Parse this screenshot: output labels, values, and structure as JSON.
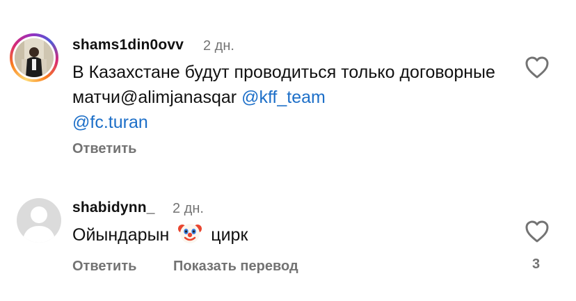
{
  "comments": [
    {
      "username": "shams1din0ovv",
      "time": "2 дн.",
      "text": "В Казахстане будут проводиться только договорные матчи@alimjanasqar",
      "mentions": [
        "@kff_team",
        "@fc.turan"
      ],
      "reply_label": "Ответить"
    },
    {
      "username": "shabidynn_",
      "time": "2 дн.",
      "text_before": "Ойындарын",
      "emoji": "clown-face",
      "text_after": "цирк",
      "reply_label": "Ответить",
      "translate_label": "Показать перевод",
      "likes": "3"
    }
  ],
  "colors": {
    "mention": "#1d6fc8",
    "muted": "#737373",
    "text": "#111111"
  }
}
